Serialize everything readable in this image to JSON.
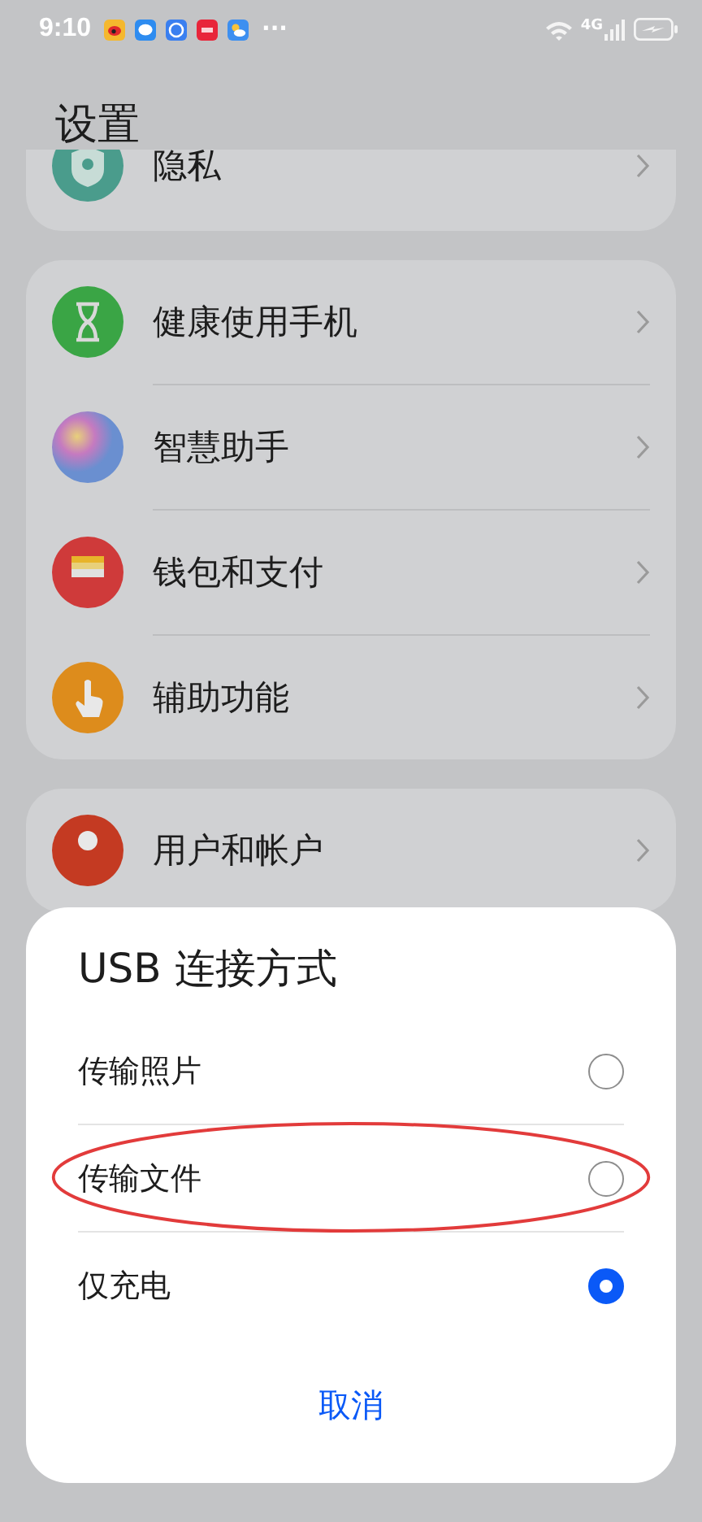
{
  "status_bar": {
    "time": "9:10",
    "notifications": [
      {
        "kind": "weibo"
      },
      {
        "kind": "message"
      },
      {
        "kind": "browser"
      },
      {
        "kind": "news"
      },
      {
        "kind": "weather"
      }
    ],
    "more": "···",
    "network": "4G"
  },
  "title": "设置",
  "groups": [
    {
      "items": [
        {
          "label": "隐私",
          "kind": "privacy"
        }
      ]
    },
    {
      "items": [
        {
          "label": "健康使用手机",
          "kind": "hourglass"
        },
        {
          "label": "智慧助手",
          "kind": "assistant"
        },
        {
          "label": "钱包和支付",
          "kind": "wallet"
        },
        {
          "label": "辅助功能",
          "kind": "hand"
        }
      ]
    },
    {
      "items": [
        {
          "label": "用户和帐户",
          "kind": "user"
        }
      ]
    }
  ],
  "sheet": {
    "title": "USB 连接方式",
    "options": [
      {
        "label": "传输照片",
        "selected": false,
        "highlighted": false
      },
      {
        "label": "传输文件",
        "selected": false,
        "highlighted": true
      },
      {
        "label": "仅充电",
        "selected": true,
        "highlighted": false
      }
    ],
    "cancel": "取消"
  }
}
